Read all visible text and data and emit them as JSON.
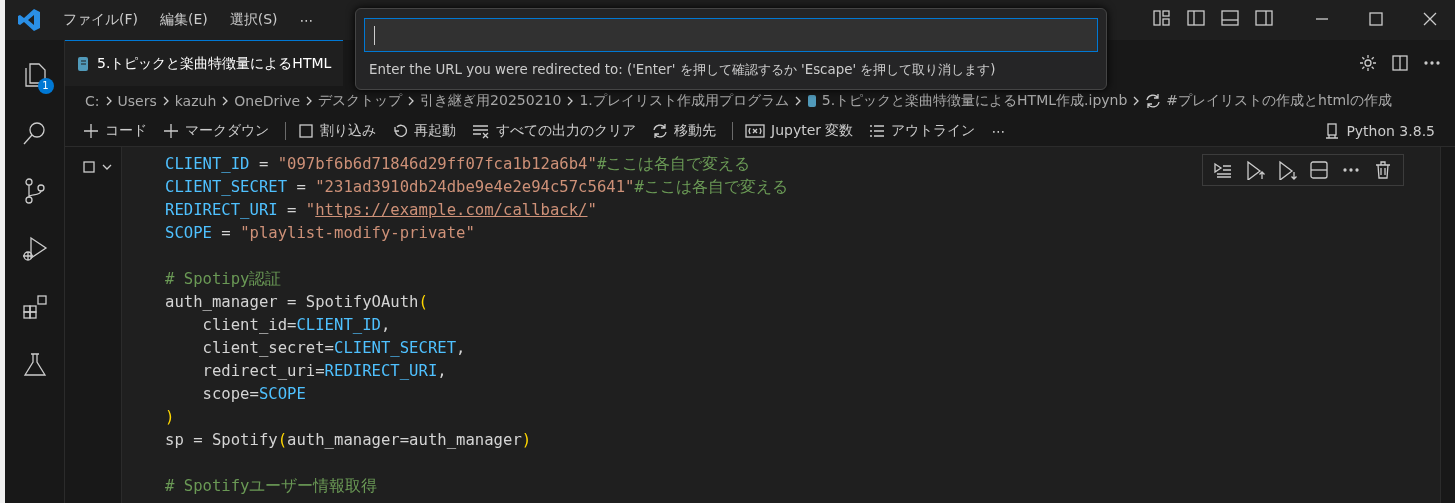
{
  "title_bar": {
    "menu": [
      "ファイル(F)",
      "編集(E)",
      "選択(S)",
      "⋯"
    ]
  },
  "activity_bar": {
    "items": [
      {
        "kind": "files",
        "badge": "1"
      },
      {
        "kind": "search"
      },
      {
        "kind": "source-control"
      },
      {
        "kind": "run-debug"
      },
      {
        "kind": "extensions"
      },
      {
        "kind": "testing"
      }
    ]
  },
  "editor_tab": {
    "title": "5.トピックと楽曲特徴量によるHTML"
  },
  "breadcrumbs": [
    {
      "text": "C:",
      "kind": "folder"
    },
    {
      "text": "Users",
      "kind": "folder"
    },
    {
      "text": "kazuh",
      "kind": "folder"
    },
    {
      "text": "OneDrive",
      "kind": "folder"
    },
    {
      "text": "デスクトップ",
      "kind": "folder"
    },
    {
      "text": "引き継ぎ用20250210",
      "kind": "folder"
    },
    {
      "text": "1.プレイリスト作成用プログラム",
      "kind": "folder"
    },
    {
      "text": "5.トピックと楽曲特徴量によるHTML作成.ipynb",
      "kind": "notebook"
    },
    {
      "text": "#プレイリストの作成とhtmlの作成",
      "kind": "cell"
    }
  ],
  "notebook_toolbar": {
    "items": [
      {
        "kind": "add",
        "label": "コード"
      },
      {
        "kind": "add",
        "label": "マークダウン"
      },
      {
        "kind": "separator"
      },
      {
        "kind": "interrupt",
        "label": "割り込み"
      },
      {
        "kind": "restart",
        "label": "再起動"
      },
      {
        "kind": "clear",
        "label": "すべての出力のクリア"
      },
      {
        "kind": "goto",
        "label": "移動先"
      },
      {
        "kind": "separator"
      },
      {
        "kind": "variables",
        "label": "Jupyter 変数"
      },
      {
        "kind": "outline",
        "label": "アウトライン"
      },
      {
        "kind": "more",
        "label": "⋯"
      }
    ],
    "kernel": "Python 3.8.5"
  },
  "cell": {
    "lines": [
      {
        "kind": "code",
        "tokens": [
          {
            "kind": "constant",
            "text": "CLIENT_ID"
          },
          {
            "kind": "plain",
            "text": " = "
          },
          {
            "kind": "string",
            "text": "\"097bf6b6d71846d29ff07fca1b12a6b4\""
          },
          {
            "kind": "comment",
            "text": "#ここは各自で変える"
          }
        ]
      },
      {
        "kind": "code",
        "tokens": [
          {
            "kind": "constant",
            "text": "CLIENT_SECRET"
          },
          {
            "kind": "plain",
            "text": " = "
          },
          {
            "kind": "string",
            "text": "\"231ad3910db24dbe9e4e2e94c57c5641\""
          },
          {
            "kind": "comment",
            "text": "#ここは各自で変える"
          }
        ]
      },
      {
        "kind": "code",
        "tokens": [
          {
            "kind": "constant",
            "text": "REDIRECT_URI"
          },
          {
            "kind": "plain",
            "text": " = "
          },
          {
            "kind": "string",
            "text": "\""
          },
          {
            "kind": "url",
            "text": "https://example.com/callback/"
          },
          {
            "kind": "string",
            "text": "\""
          }
        ]
      },
      {
        "kind": "code",
        "tokens": [
          {
            "kind": "constant",
            "text": "SCOPE"
          },
          {
            "kind": "plain",
            "text": " = "
          },
          {
            "kind": "string",
            "text": "\"playlist-modify-private\""
          }
        ]
      },
      {
        "kind": "blank"
      },
      {
        "kind": "code",
        "tokens": [
          {
            "kind": "comment",
            "text": "# Spotipy認証"
          }
        ]
      },
      {
        "kind": "code",
        "tokens": [
          {
            "kind": "plain",
            "text": "auth_manager = SpotifyOAuth"
          },
          {
            "kind": "bracket",
            "text": "("
          }
        ]
      },
      {
        "kind": "code",
        "tokens": [
          {
            "kind": "plain",
            "text": "    client_id="
          },
          {
            "kind": "constant",
            "text": "CLIENT_ID"
          },
          {
            "kind": "plain",
            "text": ","
          }
        ]
      },
      {
        "kind": "code",
        "tokens": [
          {
            "kind": "plain",
            "text": "    client_secret="
          },
          {
            "kind": "constant",
            "text": "CLIENT_SECRET"
          },
          {
            "kind": "plain",
            "text": ","
          }
        ]
      },
      {
        "kind": "code",
        "tokens": [
          {
            "kind": "plain",
            "text": "    redirect_uri="
          },
          {
            "kind": "constant",
            "text": "REDIRECT_URI"
          },
          {
            "kind": "plain",
            "text": ","
          }
        ]
      },
      {
        "kind": "code",
        "tokens": [
          {
            "kind": "plain",
            "text": "    scope="
          },
          {
            "kind": "constant",
            "text": "SCOPE"
          }
        ]
      },
      {
        "kind": "code",
        "tokens": [
          {
            "kind": "bracket",
            "text": ")"
          }
        ]
      },
      {
        "kind": "code",
        "tokens": [
          {
            "kind": "plain",
            "text": "sp = Spotify"
          },
          {
            "kind": "bracket",
            "text": "("
          },
          {
            "kind": "plain",
            "text": "auth_manager=auth_manager"
          },
          {
            "kind": "bracket",
            "text": ")"
          }
        ]
      },
      {
        "kind": "blank"
      },
      {
        "kind": "code",
        "tokens": [
          {
            "kind": "comment",
            "text": "# Spotifyユーザー情報取得"
          }
        ]
      }
    ]
  },
  "quick_input": {
    "message": "Enter the URL you were redirected to: ('Enter' を押して確認するか 'Escape' を押して取り消します)"
  }
}
